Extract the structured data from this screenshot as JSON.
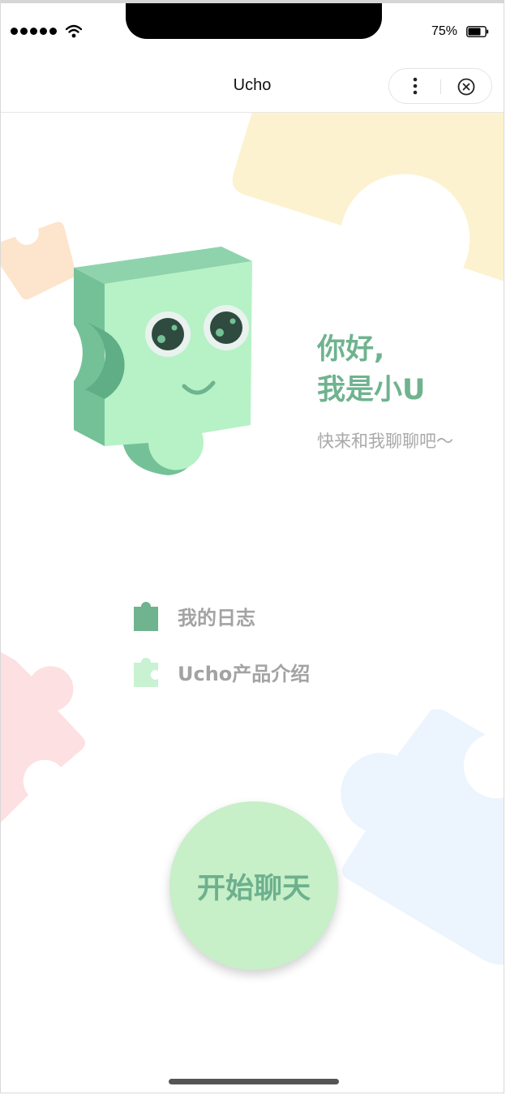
{
  "status_bar": {
    "battery_percent": "75%",
    "battery_level": 0.75
  },
  "nav": {
    "title": "Ucho"
  },
  "greeting": {
    "line1": "你好,",
    "line2": "我是小U",
    "subtitle": "快来和我聊聊吧～"
  },
  "menu": [
    {
      "label": "我的日志",
      "icon": "puzzle-icon",
      "color": "#6fb38f"
    },
    {
      "label": "Ucho产品介绍",
      "icon": "puzzle-icon",
      "color": "#c8f2d2"
    }
  ],
  "start_button": {
    "label": "开始聊天"
  },
  "colors": {
    "accent": "#6fb38f",
    "button": "#c7efc8",
    "muted": "#a9a9a9"
  }
}
